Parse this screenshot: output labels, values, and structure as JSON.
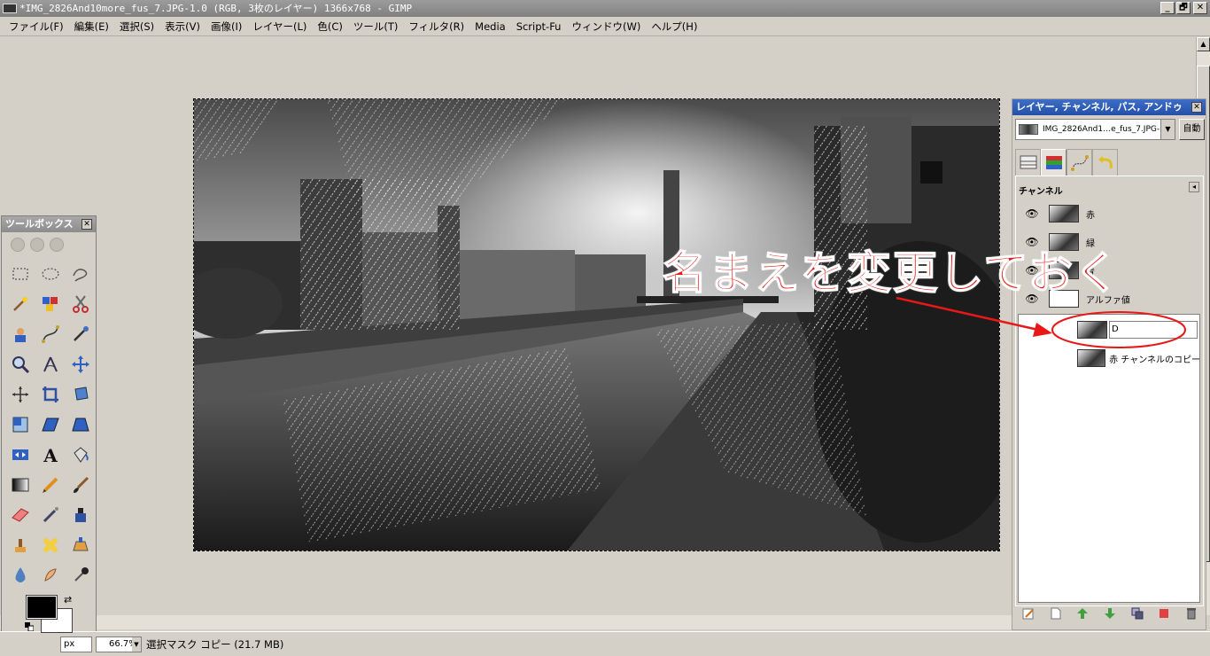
{
  "window": {
    "title": "*IMG_2826And10more_fus_7.JPG-1.0 (RGB, 3枚のレイヤー) 1366x768 - GIMP",
    "min_label": "_",
    "max_label": "🗗",
    "close_label": "✕"
  },
  "menu": [
    "ファイル(F)",
    "編集(E)",
    "選択(S)",
    "表示(V)",
    "画像(I)",
    "レイヤー(L)",
    "色(C)",
    "ツール(T)",
    "フィルタ(R)",
    "Media",
    "Script-Fu",
    "ウィンドウ(W)",
    "ヘルプ(H)"
  ],
  "toolbox": {
    "title": "ツールボックス",
    "close_label": "✕",
    "tools": [
      "rect-select-icon",
      "ellipse-select-icon",
      "free-select-icon",
      "fuzzy-select-icon",
      "color-select-icon",
      "scissors-icon",
      "foreground-select-icon",
      "paths-icon",
      "color-picker-icon",
      "zoom-icon",
      "measure-icon",
      "move-icon",
      "align-icon",
      "crop-icon",
      "rotate-icon",
      "scale-icon",
      "shear-icon",
      "perspective-icon",
      "flip-icon",
      "text-icon",
      "bucket-fill-icon",
      "blend-icon",
      "pencil-icon",
      "paintbrush-icon",
      "eraser-icon",
      "airbrush-icon",
      "ink-icon",
      "clone-icon",
      "heal-icon",
      "perspective-clone-icon",
      "blur-icon",
      "smudge-icon",
      "dodge-burn-icon"
    ],
    "fg_color": "#000000",
    "bg_color": "#ffffff"
  },
  "dock": {
    "title": "レイヤー, チャンネル, パス, アンドゥ",
    "close_label": "✕",
    "image_select": "IMG_2826And1…e_fus_7.JPG-1",
    "auto_label": "自動",
    "tabs": [
      "layers-tab-icon",
      "channels-tab-icon",
      "paths-tab-icon",
      "undo-tab-icon"
    ],
    "panel_title": "チャンネル",
    "panel_menu_label": "◂",
    "channels": [
      {
        "label": "赤",
        "thumb": "dark"
      },
      {
        "label": "緑",
        "thumb": "dark"
      },
      {
        "label": "青",
        "thumb": "dark"
      },
      {
        "label": "アルファ値",
        "thumb": "white"
      }
    ],
    "custom_channels": [
      {
        "label": "D",
        "editing": true
      },
      {
        "label": "赤 チャンネルのコピー",
        "editing": false
      }
    ],
    "buttons": [
      "edit-channel-icon",
      "new-channel-icon",
      "raise-channel-icon",
      "lower-channel-icon",
      "duplicate-channel-icon",
      "channel-to-selection-icon",
      "delete-channel-icon"
    ]
  },
  "status": {
    "unit": "px",
    "zoom": "66.7%",
    "message": "選択マスク コピー (21.7 MB)"
  },
  "annotation": {
    "text": "名まえを変更しておく",
    "color": "#e81818"
  }
}
